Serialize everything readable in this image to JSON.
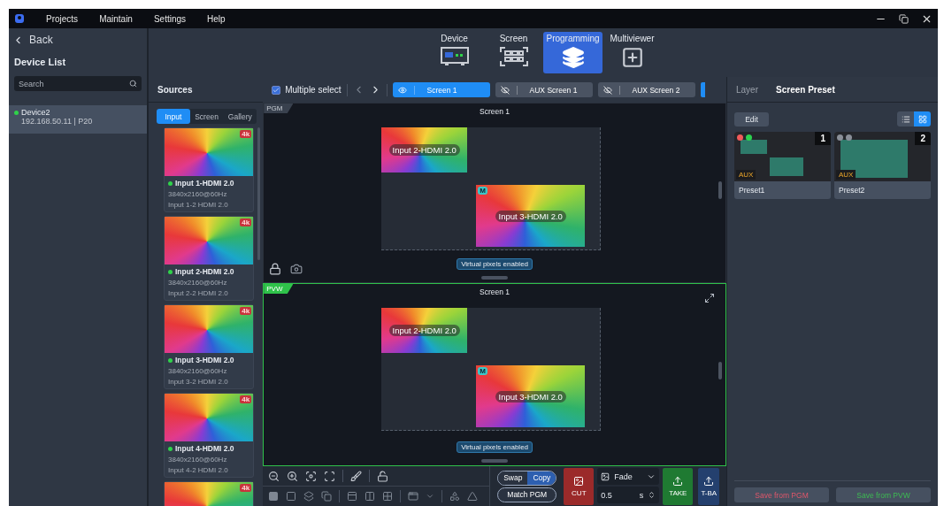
{
  "menu_bar": {
    "items": [
      "Projects",
      "Maintain",
      "Settings",
      "Help"
    ]
  },
  "sidebar": {
    "back": "Back",
    "title": "Device List",
    "search": {
      "placeholder": "Search"
    },
    "devices": [
      {
        "name": "Device2",
        "detail": "192.168.50.11 | P20",
        "selected": true,
        "online": true
      }
    ]
  },
  "nav_tabs": [
    {
      "label": "Device",
      "kind": "device",
      "selected": false
    },
    {
      "label": "Screen",
      "kind": "screen",
      "selected": false
    },
    {
      "label": "Programming",
      "kind": "layers",
      "selected": true
    },
    {
      "label": "Multiviewer",
      "kind": "multiviewer",
      "selected": false
    }
  ],
  "sources": {
    "title": "Sources",
    "tabs": [
      {
        "label": "Input",
        "selected": true
      },
      {
        "label": "Screen",
        "selected": false
      },
      {
        "label": "Gallery",
        "selected": false
      }
    ],
    "items": [
      {
        "badge": "4k",
        "name": "Input 1-HDMI 2.0",
        "online": true,
        "resolution": "3840x2160@60Hz",
        "detail": "Input 1-2  HDMI 2.0"
      },
      {
        "badge": "4k",
        "name": "Input 2-HDMI 2.0",
        "online": true,
        "resolution": "3840x2160@60Hz",
        "detail": "Input 2-2  HDMI 2.0"
      },
      {
        "badge": "4k",
        "name": "Input 3-HDMI 2.0",
        "online": true,
        "resolution": "3840x2160@60Hz",
        "detail": "Input 3-2  HDMI 2.0"
      },
      {
        "badge": "4k",
        "name": "Input 4-HDMI 2.0",
        "online": true,
        "resolution": "3840x2160@60Hz",
        "detail": "Input 4-2  HDMI 2.0"
      },
      {
        "badge": "4k"
      }
    ]
  },
  "toolbar": {
    "multiple_select": {
      "label": "Multiple select",
      "checked": true
    },
    "screens": [
      {
        "label": "Screen 1",
        "selected": true,
        "visible": true
      },
      {
        "label": "AUX Screen 1",
        "selected": false,
        "visible": false
      },
      {
        "label": "AUX Screen 2",
        "selected": false,
        "visible": false
      }
    ]
  },
  "views": [
    {
      "tag": "PGM",
      "kind": "pgm",
      "title": "Screen 1",
      "layers": [
        {
          "label": "Input 2-HDMI 2.0"
        },
        {
          "label": "Input 3-HDMI 2.0",
          "badge": "M"
        }
      ],
      "notice": "Virtual pixels enabled"
    },
    {
      "tag": "PVW",
      "kind": "pvw",
      "title": "Screen 1",
      "layers": [
        {
          "label": "Input 2-HDMI 2.0"
        },
        {
          "label": "Input 3-HDMI 2.0",
          "badge": "M"
        }
      ],
      "notice": "Virtual pixels enabled"
    }
  ],
  "controls": {
    "swap": "Swap",
    "copy": "Copy",
    "match": "Match PGM",
    "cut": "CUT",
    "transition": "Fade",
    "duration": "0.5",
    "unit": "s",
    "take": "TAKE",
    "tbar": "T-BA"
  },
  "right_panel": {
    "tabs": [
      {
        "label": "Layer",
        "selected": false
      },
      {
        "label": "Screen Preset",
        "selected": true
      }
    ],
    "edit": "Edit",
    "view_modes": [
      {
        "kind": "list",
        "selected": false
      },
      {
        "kind": "grid",
        "selected": true
      }
    ],
    "presets": [
      {
        "name": "Preset1",
        "number": "1",
        "tag": "AUX",
        "dots": [
          {
            "color": "#f05a5a"
          },
          {
            "color": "#2bd24f"
          }
        ]
      },
      {
        "name": "Preset2",
        "number": "2",
        "tag": "AUX",
        "dots": [
          {
            "color": "#8a8f98"
          },
          {
            "color": "#8a8f98"
          }
        ]
      }
    ],
    "save_buttons": [
      {
        "label": "Save from PGM",
        "kind": "pgm"
      },
      {
        "label": "Save from PVW",
        "kind": "pvw"
      }
    ]
  }
}
